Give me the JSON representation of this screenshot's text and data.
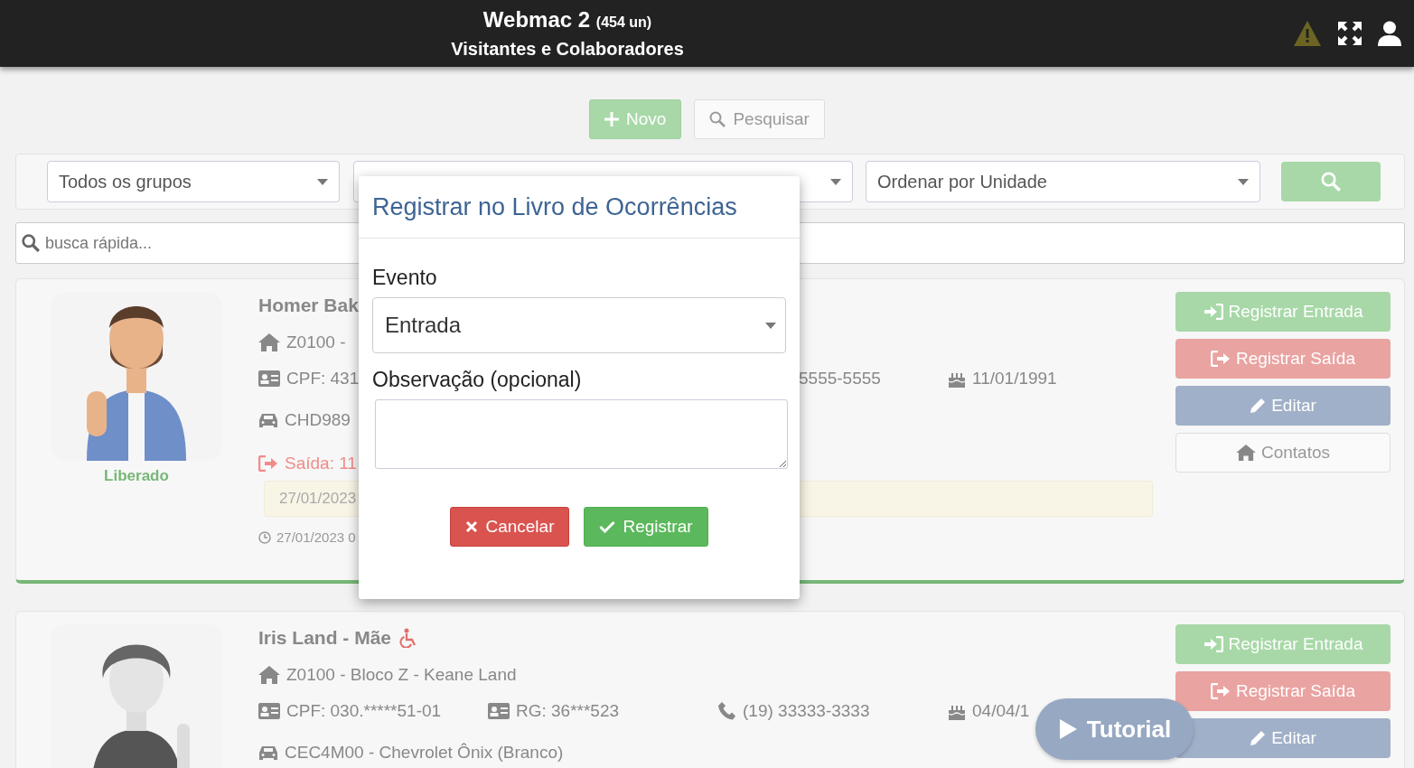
{
  "header": {
    "title": "Webmac 2",
    "count": "(454 un)",
    "subtitle": "Visitantes e Colaboradores"
  },
  "actions": [
    {
      "kind": "new",
      "label": "Novo"
    },
    {
      "kind": "search",
      "label": "Pesquisar"
    }
  ],
  "filters": {
    "group": "Todos os grupos",
    "order": "Ordenar por Unidade"
  },
  "quick_search": {
    "placeholder": "busca rápida..."
  },
  "people": [
    {
      "name": "Homer Bak",
      "accessible": false,
      "status": "Liberado",
      "address": "Z0100 -",
      "cpf": "CPF: 431",
      "phone": {
        "text": "5555-5555",
        "icon_visible": false
      },
      "birthday": "11/01/1991",
      "vehicle": "CHD989",
      "exit": "Saída: 11",
      "note": "27/01/2023",
      "timestamp": "27/01/2023 0",
      "buttons": [
        {
          "kind": "entry",
          "label": "Registrar Entrada"
        },
        {
          "kind": "exit",
          "label": "Registrar Saída"
        },
        {
          "kind": "edit",
          "label": "Editar"
        },
        {
          "kind": "contacts",
          "label": "Contatos"
        }
      ]
    },
    {
      "name": "Iris Land - Mãe",
      "accessible": true,
      "address": "Z0100 - Bloco Z - Keane Land",
      "cpf": "CPF: 030.*****51-01",
      "rg": "RG: 36***523",
      "phone": {
        "text": "(19) 33333-3333",
        "icon_visible": true
      },
      "birthday": "04/04/1",
      "vehicle": "CEC4M00 - Chevrolet Ônix (Branco)",
      "buttons": [
        {
          "kind": "entry",
          "label": "Registrar Entrada"
        },
        {
          "kind": "exit",
          "label": "Registrar Saída"
        },
        {
          "kind": "edit",
          "label": "Editar"
        }
      ]
    }
  ],
  "modal": {
    "title": "Registrar no Livro de Ocorrências",
    "event_label": "Evento",
    "event_value": "Entrada",
    "note_label": "Observação (opcional)",
    "buttons": [
      {
        "kind": "cancel",
        "label": "Cancelar"
      },
      {
        "kind": "confirm",
        "label": "Registrar"
      }
    ]
  },
  "tutorial": {
    "label": "Tutorial"
  }
}
